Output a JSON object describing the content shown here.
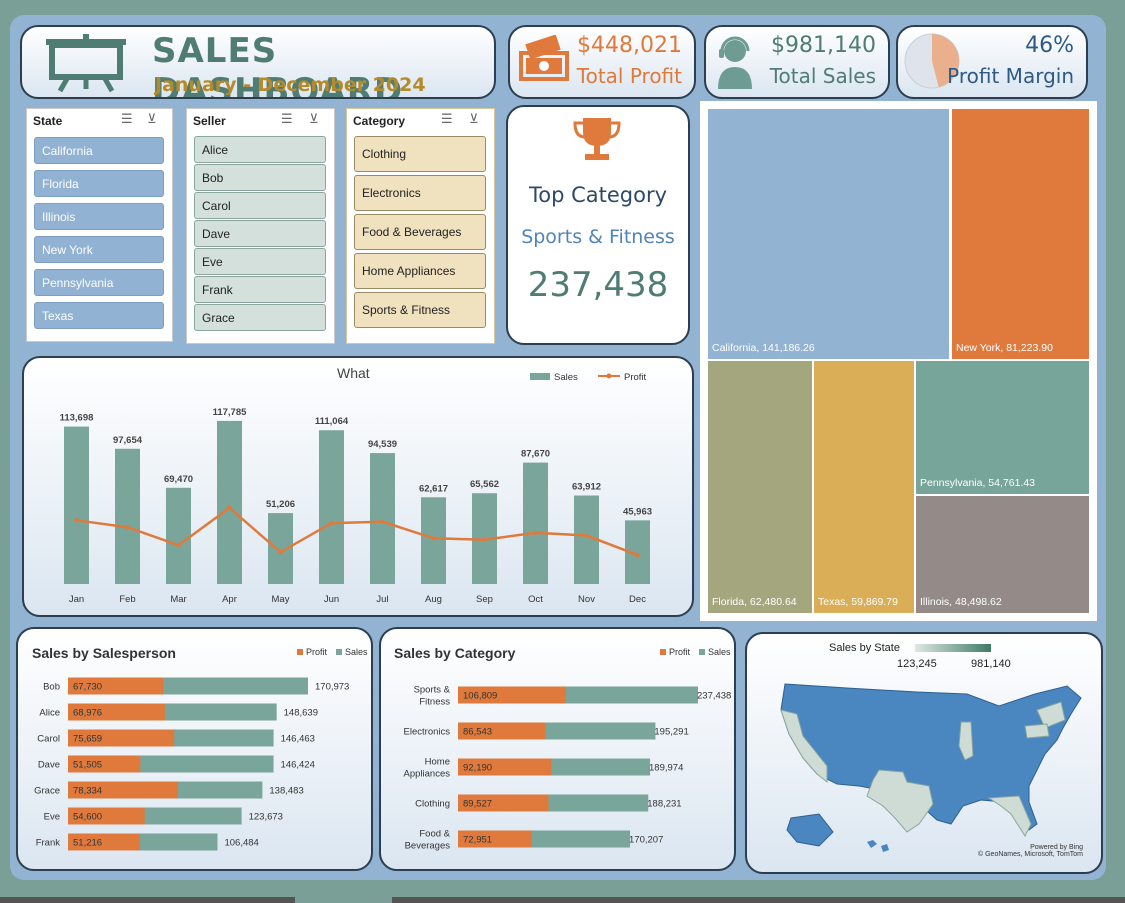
{
  "header": {
    "title": "SALES DASHBOARD",
    "subtitle": "January - December 2024"
  },
  "kpis": {
    "profit": {
      "value": "$448,021",
      "label": "Total Profit"
    },
    "sales": {
      "value": "$981,140",
      "label": "Total Sales"
    },
    "margin": {
      "value": "46%",
      "label": "Profit Margin",
      "fraction": 0.46
    }
  },
  "slicers": {
    "state": {
      "title": "State",
      "items": [
        "California",
        "Florida",
        "Illinois",
        "New York",
        "Pennsylvania",
        "Texas"
      ]
    },
    "seller": {
      "title": "Seller",
      "items": [
        "Alice",
        "Bob",
        "Carol",
        "Dave",
        "Eve",
        "Frank",
        "Grace"
      ]
    },
    "category": {
      "title": "Category",
      "items": [
        "Clothing",
        "Electronics",
        "Food & Beverages",
        "Home Appliances",
        "Sports & Fitness"
      ]
    }
  },
  "top_category": {
    "heading": "Top Category",
    "name": "Sports & Fitness",
    "value": "237,438"
  },
  "colors": {
    "sales": "#7aa59b",
    "profit": "#e07a3c",
    "steel": "#4a86c0",
    "pale": "#cfdcd6"
  },
  "chart_data": [
    {
      "type": "bar",
      "title": "What",
      "categories": [
        "Jan",
        "Feb",
        "Mar",
        "Apr",
        "May",
        "Jun",
        "Jul",
        "Aug",
        "Sep",
        "Oct",
        "Nov",
        "Dec"
      ],
      "series": [
        {
          "name": "Sales",
          "type": "bar",
          "values": [
            113698,
            97654,
            69470,
            117785,
            51206,
            111064,
            94539,
            62617,
            65562,
            87670,
            63912,
            45963
          ]
        },
        {
          "name": "Profit",
          "type": "line",
          "values": [
            46000,
            41000,
            28000,
            55000,
            23000,
            44000,
            45000,
            33000,
            32000,
            37000,
            35000,
            21000
          ]
        }
      ],
      "data_labels": [
        "113,698",
        "97,654",
        "69,470",
        "117,785",
        "51,206",
        "111,064",
        "94,539",
        "62,617",
        "65,562",
        "87,670",
        "63,912",
        "45,963"
      ],
      "ylim": [
        0,
        130000
      ],
      "legend": "top-right",
      "grid": false
    },
    {
      "type": "bar",
      "orientation": "horizontal",
      "title": "Sales by Salesperson",
      "categories": [
        "Bob",
        "Alice",
        "Carol",
        "Dave",
        "Grace",
        "Eve",
        "Frank"
      ],
      "series": [
        {
          "name": "Profit",
          "values": [
            67730,
            68976,
            75659,
            51505,
            78334,
            54600,
            51216
          ]
        },
        {
          "name": "Sales",
          "values": [
            170973,
            148639,
            146463,
            146424,
            138483,
            123673,
            106484
          ]
        }
      ],
      "profit_labels": [
        "67,730",
        "68,976",
        "75,659",
        "51,505",
        "78,334",
        "54,600",
        "51,216"
      ],
      "sales_labels": [
        "170,973",
        "148,639",
        "146,463",
        "146,424",
        "138,483",
        "123,673",
        "106,484"
      ],
      "legend": "top-right"
    },
    {
      "type": "bar",
      "orientation": "horizontal",
      "title": "Sales by Category",
      "categories": [
        "Sports & Fitness",
        "Electronics",
        "Home Appliances",
        "Clothing",
        "Food & Beverages"
      ],
      "category_lines": [
        [
          "Sports &",
          "Fitness"
        ],
        [
          "Electronics"
        ],
        [
          "Home",
          "Appliances"
        ],
        [
          "Clothing"
        ],
        [
          "Food &",
          "Beverages"
        ]
      ],
      "series": [
        {
          "name": "Profit",
          "values": [
            106809,
            86543,
            92190,
            89527,
            72951
          ]
        },
        {
          "name": "Sales",
          "values": [
            237438,
            195291,
            189974,
            188231,
            170207
          ]
        }
      ],
      "profit_labels": [
        "106,809",
        "86,543",
        "92,190",
        "89,527",
        "72,951"
      ],
      "sales_labels": [
        "237,438",
        "195,291",
        "189,974",
        "188,231",
        "170,207"
      ],
      "legend": "top-right"
    },
    {
      "type": "treemap",
      "items": [
        {
          "name": "California",
          "value": 141186.26,
          "label": "California,  141,186.26",
          "color": "#93b3d3"
        },
        {
          "name": "New York",
          "value": 81223.9,
          "label": "New York,  81,223.90",
          "color": "#e07a3c"
        },
        {
          "name": "Florida",
          "value": 62480.64,
          "label": "Florida,  62,480.64",
          "color": "#a4a77e"
        },
        {
          "name": "Texas",
          "value": 59869.79,
          "label": "Texas,  59,869.79",
          "color": "#d9ae56"
        },
        {
          "name": "Pennsylvania",
          "value": 54761.43,
          "label": "Pennsylvania,  54,761.43",
          "color": "#78a599"
        },
        {
          "name": "Illinois",
          "value": 48498.62,
          "label": "Illinois,  48,498.62",
          "color": "#948b89"
        }
      ]
    }
  ],
  "map": {
    "title": "Sales by State",
    "legend_min": "123,245",
    "legend_max": "981,140",
    "credit_line1": "Powered by Bing",
    "credit_line2": "© GeoNames, Microsoft, TomTom"
  }
}
